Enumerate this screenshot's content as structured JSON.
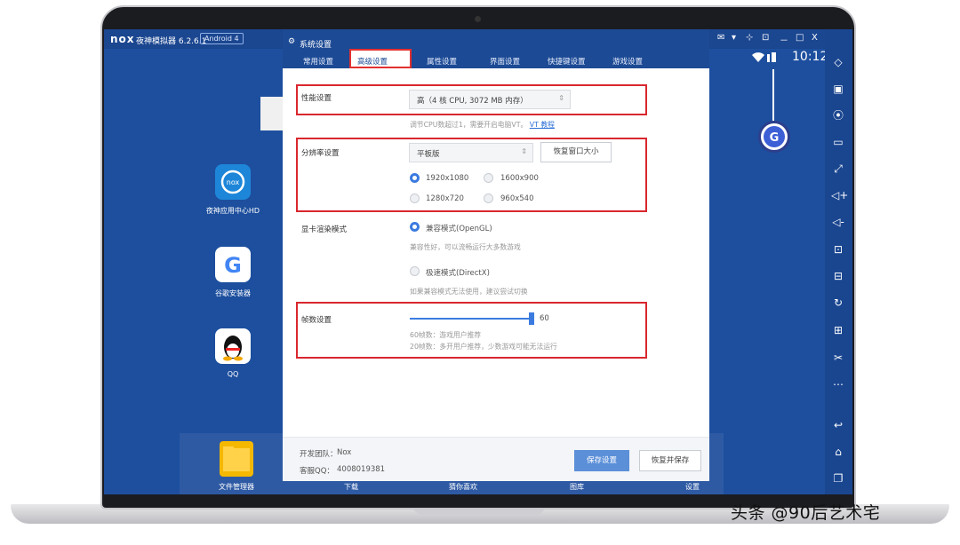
{
  "emulator": {
    "logo": "nox",
    "title": "夜神模拟器 6.2.6.1",
    "android_badge": "Android 4",
    "window_controls": [
      "x",
      "✉",
      "▾",
      "⊹",
      "⊡",
      "－",
      "□",
      "X",
      "≪"
    ]
  },
  "status_bar": {
    "time": "10:12"
  },
  "desktop": {
    "apps": [
      {
        "label": "夜神应用中心HD"
      },
      {
        "label": "谷歌安装器"
      },
      {
        "label": "QQ"
      }
    ],
    "dock": {
      "labels": [
        "文件管理器",
        "下载",
        "猜你喜欢",
        "图库",
        "设置"
      ]
    }
  },
  "dialog": {
    "title": "系统设置",
    "tabs": [
      "常用设置",
      "高级设置",
      "属性设置",
      "界面设置",
      "快捷键设置",
      "游戏设置"
    ],
    "selected_tab": "高级设置",
    "performance": {
      "label": "性能设置",
      "selected": "高（4 核 CPU, 3072 MB 内存）",
      "hint": "调节CPU数超过1，需要开启电脑VT。",
      "hint_link": "VT 教程"
    },
    "resolution": {
      "label": "分辨率设置",
      "selected": "平板版",
      "restore_button": "恢复窗口大小",
      "options": [
        "1920x1080",
        "1600x900",
        "1280x720",
        "960x540"
      ],
      "checked": "1920x1080"
    },
    "render": {
      "label": "显卡渲染模式",
      "options": [
        {
          "name": "兼容模式(OpenGL)",
          "hint": "兼容性好，可以流畅运行大多数游戏",
          "checked": true
        },
        {
          "name": "极速模式(DirectX)",
          "hint": "如果兼容模式无法使用，建议尝试切换",
          "checked": false
        }
      ]
    },
    "fps": {
      "label": "帧数设置",
      "value": "60",
      "slider_level": 1.0,
      "hint1": "60帧数：游戏用户推荐",
      "hint2": "20帧数：多开用户推荐，少数游戏可能无法运行"
    },
    "footer": {
      "team_label": "开发团队：",
      "team_value": "Nox",
      "qq_label": "客服QQ：",
      "qq_value": "4008019381",
      "save_button": "保存设置",
      "restore_save_button": "恢复并保存"
    }
  },
  "watermark": "头条 @90后艺术宅",
  "colors": {
    "accent": "#3b7be0",
    "highlight_box": "#d9272e",
    "screen_bg": "#1d4f9e"
  }
}
